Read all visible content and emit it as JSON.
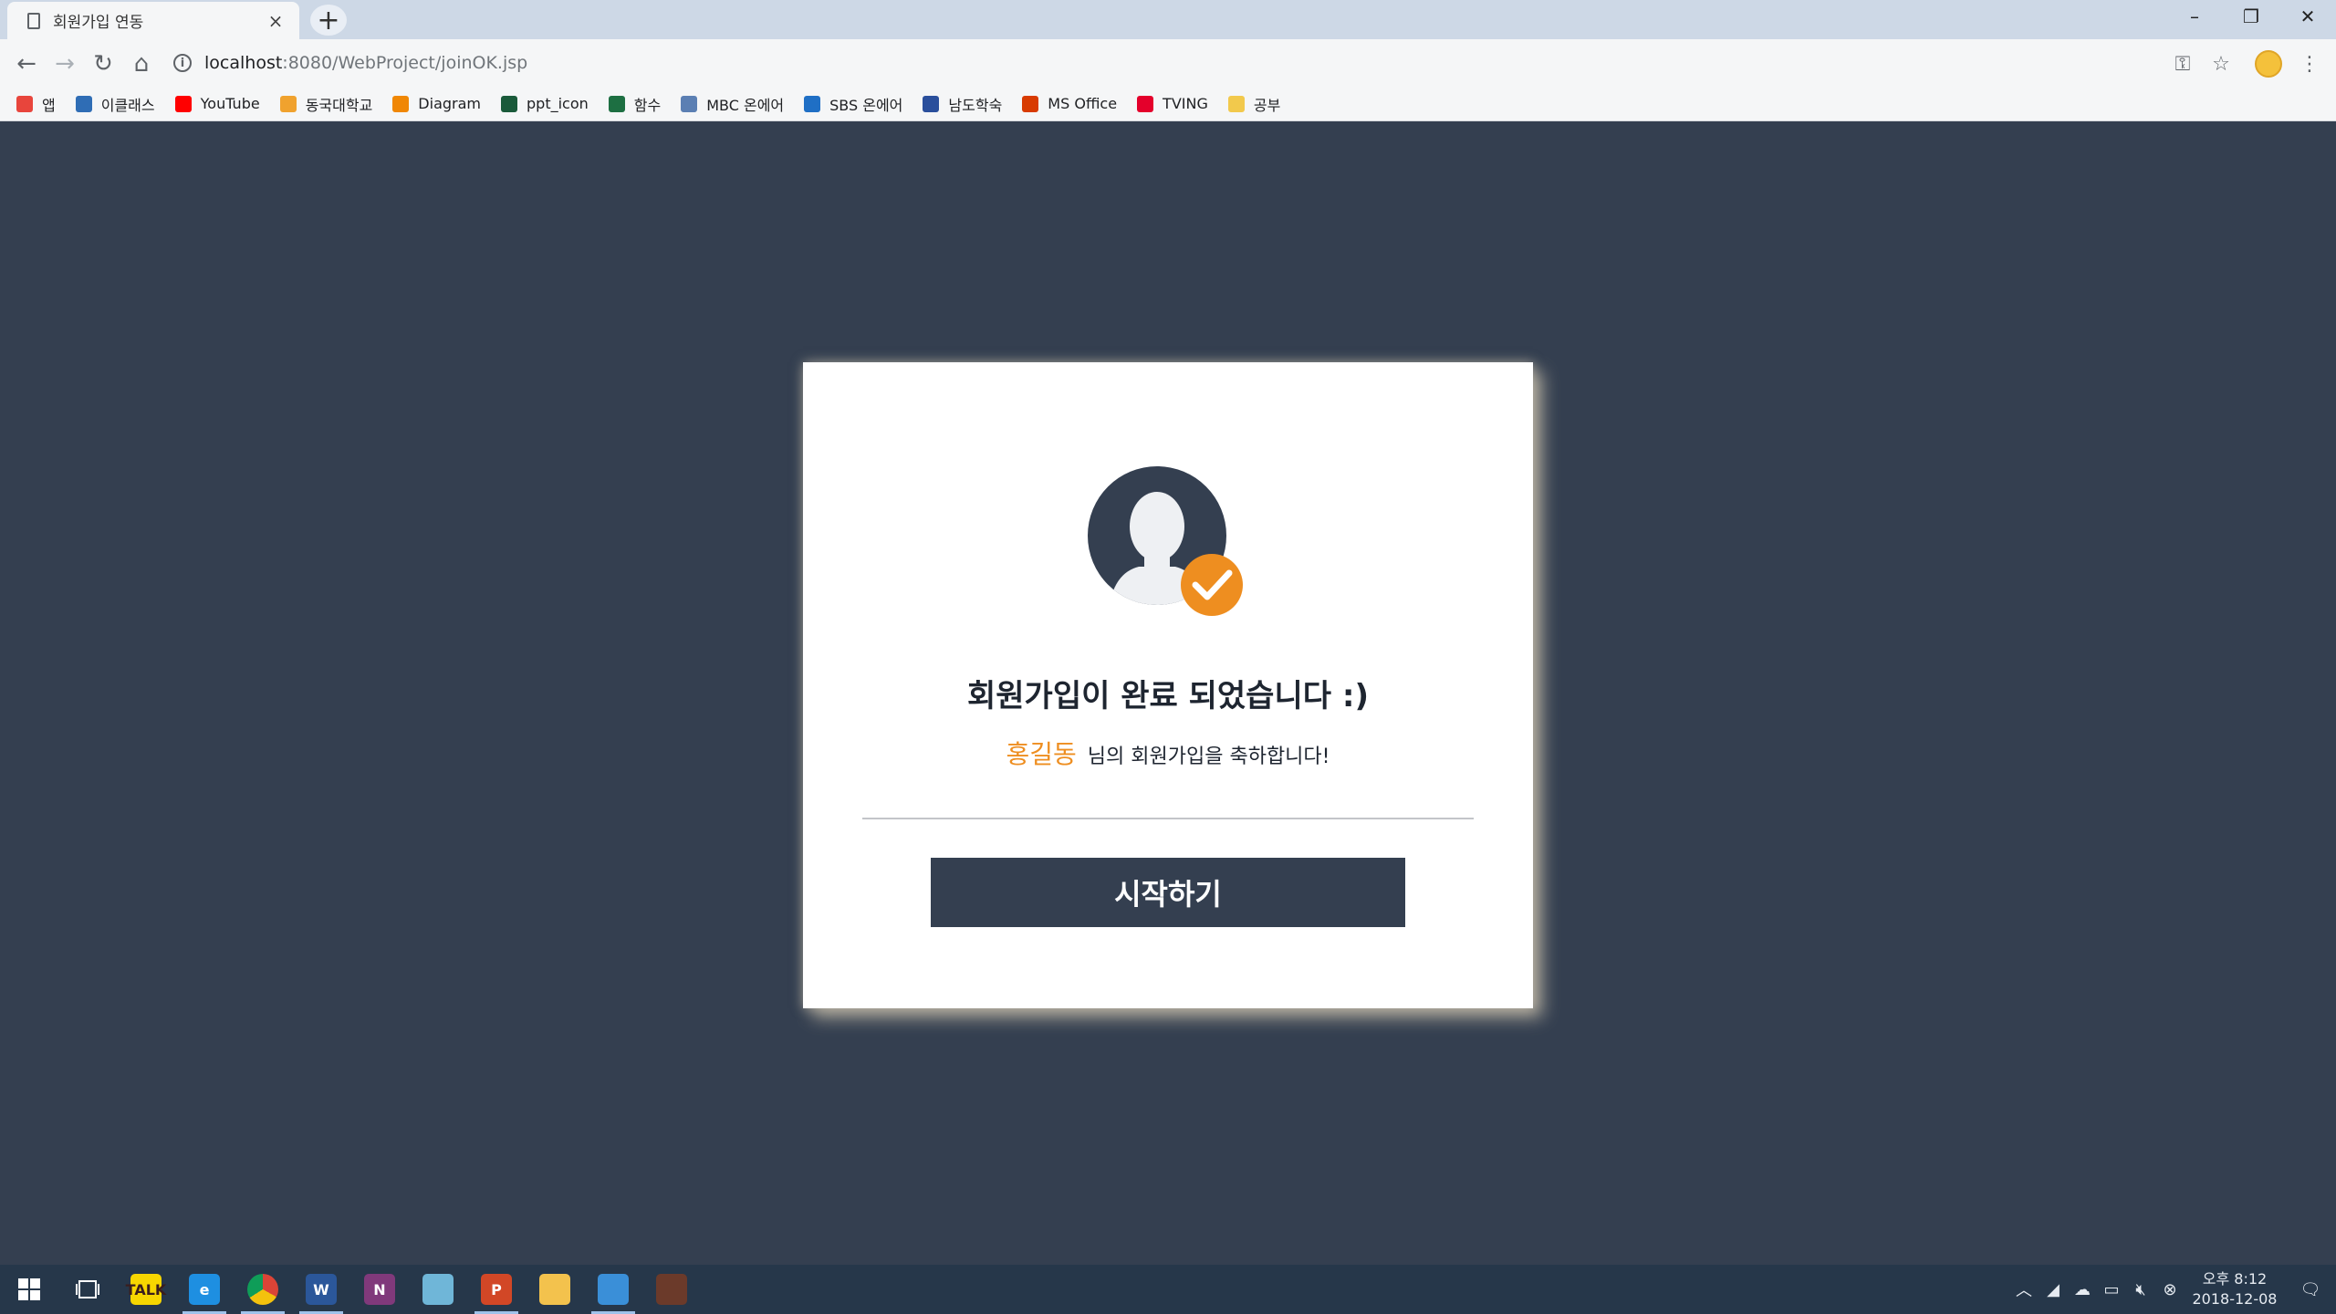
{
  "browser": {
    "tab_title": "회원가입 연동",
    "tab_close": "×",
    "new_tab": "+",
    "url_host": "localhost",
    "url_path": ":8080/WebProject/joinOK.jsp",
    "window_controls": {
      "minimize": "–",
      "restore": "❐",
      "close": "✕"
    },
    "nav": {
      "back": "←",
      "forward": "→",
      "reload": "↻",
      "home": "⌂"
    },
    "bookmarks": [
      {
        "label": "앱",
        "icon": "apps-grid-icon",
        "color": "#e8453c"
      },
      {
        "label": "이클래스",
        "icon": "eclass-icon",
        "color": "#2f6db5"
      },
      {
        "label": "YouTube",
        "icon": "youtube-icon",
        "color": "#ff0000"
      },
      {
        "label": "동국대학교",
        "icon": "dongguk-icon",
        "color": "#f0a22e"
      },
      {
        "label": "Diagram",
        "icon": "diagram-icon",
        "color": "#f08705"
      },
      {
        "label": "ppt_icon",
        "icon": "ppt-icon-bookmark-icon",
        "color": "#1a5a3a"
      },
      {
        "label": "함수",
        "icon": "function-icon",
        "color": "#1d6f42"
      },
      {
        "label": "MBC 온에어",
        "icon": "mbc-icon",
        "color": "#5b7fb3"
      },
      {
        "label": "SBS 온에어",
        "icon": "sbs-icon",
        "color": "#1f6fc5"
      },
      {
        "label": "남도학숙",
        "icon": "namdo-icon",
        "color": "#2a4f9c"
      },
      {
        "label": "MS Office",
        "icon": "office-icon",
        "color": "#d83b01"
      },
      {
        "label": "TVING",
        "icon": "tving-icon",
        "color": "#e4002b"
      },
      {
        "label": "공부",
        "icon": "folder-icon",
        "color": "#f2c94c"
      }
    ]
  },
  "card": {
    "headline": "회원가입이 완료 되었습니다 :)",
    "user_name": "홍길동",
    "congrats": "님의 회원가입을 축하합니다!",
    "start_button": "시작하기",
    "colors": {
      "accent": "#ee8e20",
      "navy": "#343f50"
    }
  },
  "taskbar": {
    "apps": [
      {
        "name": "kakaotalk",
        "label": "TALK",
        "color": "#f7d600",
        "text_color": "#3a1d1d"
      },
      {
        "name": "internet-explorer",
        "label": "e",
        "color": "#1e8fe1",
        "text_color": "#ffffff"
      },
      {
        "name": "chrome",
        "label": "",
        "color": "#db4437",
        "text_color": "#ffffff"
      },
      {
        "name": "word",
        "label": "W",
        "color": "#2b579a",
        "text_color": "#ffffff"
      },
      {
        "name": "onenote",
        "label": "N",
        "color": "#80397b",
        "text_color": "#ffffff"
      },
      {
        "name": "notepad",
        "label": "",
        "color": "#6fb6d8",
        "text_color": "#ffffff"
      },
      {
        "name": "powerpoint",
        "label": "P",
        "color": "#d24726",
        "text_color": "#ffffff"
      },
      {
        "name": "file-explorer",
        "label": "",
        "color": "#f3c24d",
        "text_color": "#ffffff"
      },
      {
        "name": "snipping-tool",
        "label": "",
        "color": "#3a8fd8",
        "text_color": "#ffffff"
      },
      {
        "name": "game-app",
        "label": "",
        "color": "#6b3a2a",
        "text_color": "#ffffff"
      }
    ],
    "clock_time": "오후 8:12",
    "clock_date": "2018-12-08"
  }
}
